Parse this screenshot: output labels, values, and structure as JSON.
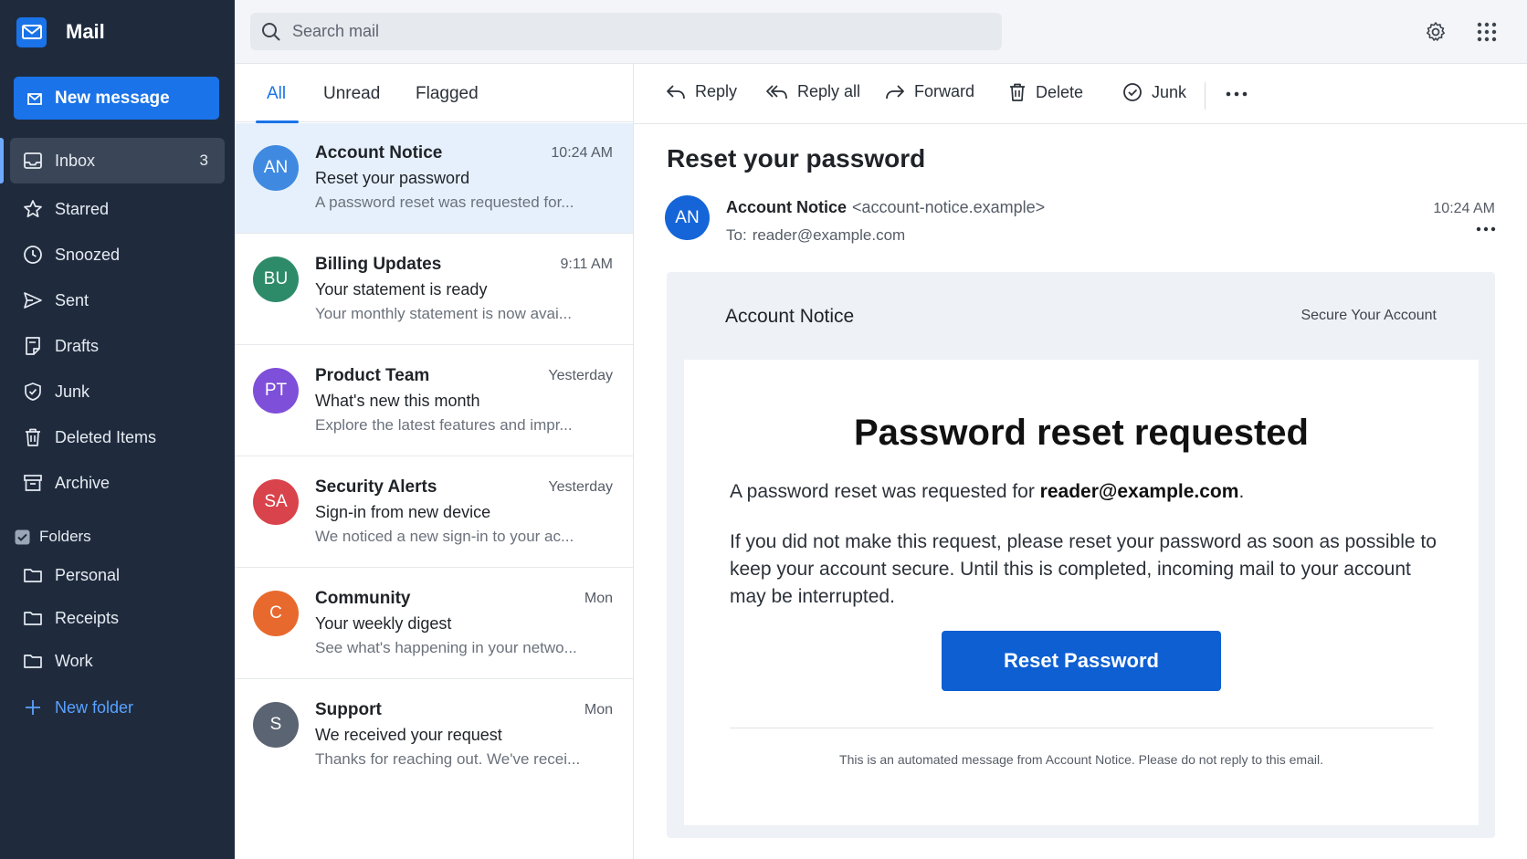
{
  "app": {
    "name": "Mail"
  },
  "sidebar": {
    "new_message_label": "New message",
    "items": [
      {
        "label": "Inbox",
        "count": "3",
        "icon": "inbox-icon"
      },
      {
        "label": "Starred",
        "icon": "star-icon"
      },
      {
        "label": "Snoozed",
        "icon": "clock-icon"
      },
      {
        "label": "Sent",
        "icon": "send-icon"
      },
      {
        "label": "Drafts",
        "icon": "draft-icon"
      },
      {
        "label": "Junk",
        "icon": "shield-icon"
      },
      {
        "label": "Deleted Items",
        "icon": "trash-icon"
      },
      {
        "label": "Archive",
        "icon": "archive-icon"
      }
    ],
    "folders_heading": "Folders",
    "folders": [
      {
        "label": "Personal"
      },
      {
        "label": "Receipts"
      },
      {
        "label": "Work"
      }
    ],
    "new_folder_label": "New folder"
  },
  "search": {
    "placeholder": "Search mail"
  },
  "list": {
    "tabs": [
      "All",
      "Unread",
      "Flagged"
    ],
    "messages": [
      {
        "initials": "AN",
        "sender": "Account Notice",
        "time": "10:24 AM",
        "subject": "Reset your password",
        "preview": "A password reset was requested for...",
        "color": "#3f8ae0"
      },
      {
        "initials": "BU",
        "sender": "Billing Updates",
        "time": "9:11 AM",
        "subject": "Your statement is ready",
        "preview": "Your monthly statement is now avai...",
        "color": "#2e8b6a"
      },
      {
        "initials": "PT",
        "sender": "Product Team",
        "time": "Yesterday",
        "subject": "What's new this month",
        "preview": "Explore the latest features and impr...",
        "color": "#7e4fd8"
      },
      {
        "initials": "SA",
        "sender": "Security Alerts",
        "time": "Yesterday",
        "subject": "Sign-in from new device",
        "preview": "We noticed a new sign-in to your ac...",
        "color": "#d9434b"
      },
      {
        "initials": "C",
        "sender": "Community",
        "time": "Mon",
        "subject": "Your weekly digest",
        "preview": "See what's happening in your netwo...",
        "color": "#e8692e"
      },
      {
        "initials": "S",
        "sender": "Support",
        "time": "Mon",
        "subject": "We received your request",
        "preview": "Thanks for reaching out. We've recei...",
        "color": "#5b6472"
      }
    ]
  },
  "toolbar": {
    "reply": "Reply",
    "reply_all": "Reply all",
    "forward": "Forward",
    "delete": "Delete",
    "junk": "Junk"
  },
  "message": {
    "subject": "Reset your password",
    "sender_initials": "AN",
    "sender_name": "Account Notice",
    "sender_address": "<account-notice.example>",
    "to_label": "To:",
    "to_address": "reader@example.com",
    "time": "10:24 AM",
    "body": {
      "brand": "Account Notice",
      "header_link": "Secure Your Account",
      "title": "Password reset requested",
      "para1_prefix": "A password reset was requested for ",
      "para1_email": "reader@example.com",
      "para1_suffix": ".",
      "para2": "If you did not make this request, please reset your password as soon as possible to keep your account secure. Until this is completed, incoming mail to your account may be interrupted.",
      "button": "Reset Password",
      "footer": "This is an automated message from Account Notice. Please do not reply to this email."
    }
  },
  "colors": {
    "sidebar_bg": "#1f2b3d",
    "accent": "#1a73e8",
    "selected_row": "#e6f0fc"
  }
}
